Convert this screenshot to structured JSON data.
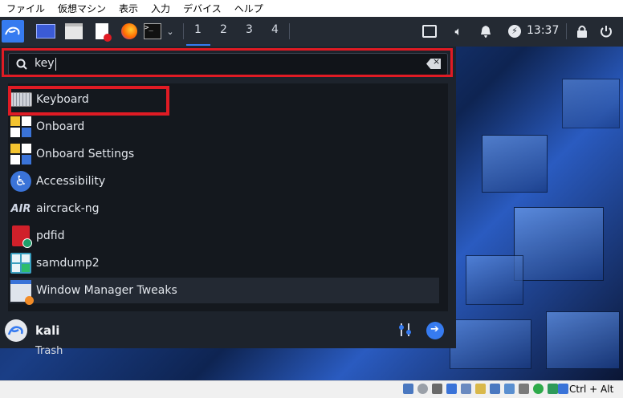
{
  "host_menu": [
    "ファイル",
    "仮想マシン",
    "表示",
    "入力",
    "デバイス",
    "ヘルプ"
  ],
  "panel": {
    "workspaces": [
      "1",
      "2",
      "3",
      "4"
    ],
    "clock": "13:37"
  },
  "search": {
    "query": "key"
  },
  "results": [
    {
      "label": "Keyboard",
      "icon": "keyboard-icon"
    },
    {
      "label": "Onboard",
      "icon": "onboard-icon"
    },
    {
      "label": "Onboard Settings",
      "icon": "onboard-settings-icon"
    },
    {
      "label": "Accessibility",
      "icon": "accessibility-icon"
    },
    {
      "label": "aircrack-ng",
      "icon": "aircrack-icon"
    },
    {
      "label": "pdfid",
      "icon": "pdf-icon"
    },
    {
      "label": "samdump2",
      "icon": "samdump-icon"
    },
    {
      "label": "Window Manager Tweaks",
      "icon": "wm-tweaks-icon"
    }
  ],
  "user": {
    "name": "kali"
  },
  "desktop": {
    "trash_label": "Trash"
  },
  "status": {
    "host_key": "Ctrl + Alt"
  },
  "colors": {
    "highlight": "#e01b24",
    "accent": "#367bf0"
  }
}
